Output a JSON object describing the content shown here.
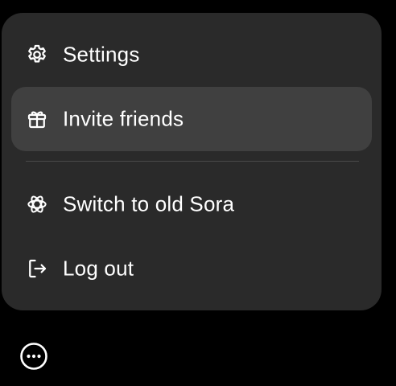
{
  "menu": {
    "items": [
      {
        "label": "Settings",
        "icon": "gear-icon"
      },
      {
        "label": "Invite friends",
        "icon": "gift-icon"
      },
      {
        "label": "Switch to old Sora",
        "icon": "openai-logo-icon"
      },
      {
        "label": "Log out",
        "icon": "log-out-icon"
      }
    ],
    "highlighted_index": 1
  },
  "more_button": {
    "icon": "more-horizontal-circle-icon"
  },
  "colors": {
    "background": "#000000",
    "menu_background": "#2a2a2a",
    "highlight": "#404040",
    "text": "#ffffff",
    "divider": "#4a4a4a"
  }
}
